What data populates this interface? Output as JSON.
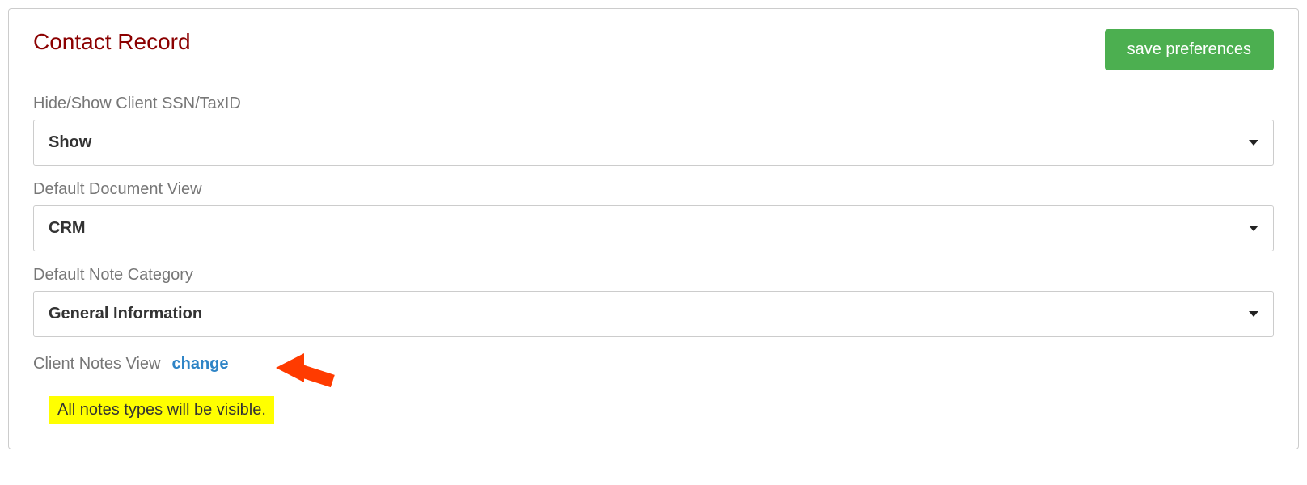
{
  "header": {
    "title": "Contact Record",
    "save_label": "save preferences"
  },
  "fields": {
    "ssn": {
      "label": "Hide/Show Client SSN/TaxID",
      "value": "Show"
    },
    "docview": {
      "label": "Default Document View",
      "value": "CRM"
    },
    "notecat": {
      "label": "Default Note Category",
      "value": "General Information"
    }
  },
  "notes_view": {
    "label": "Client Notes View",
    "change_label": "change",
    "highlight_text": "All notes types will be visible."
  }
}
